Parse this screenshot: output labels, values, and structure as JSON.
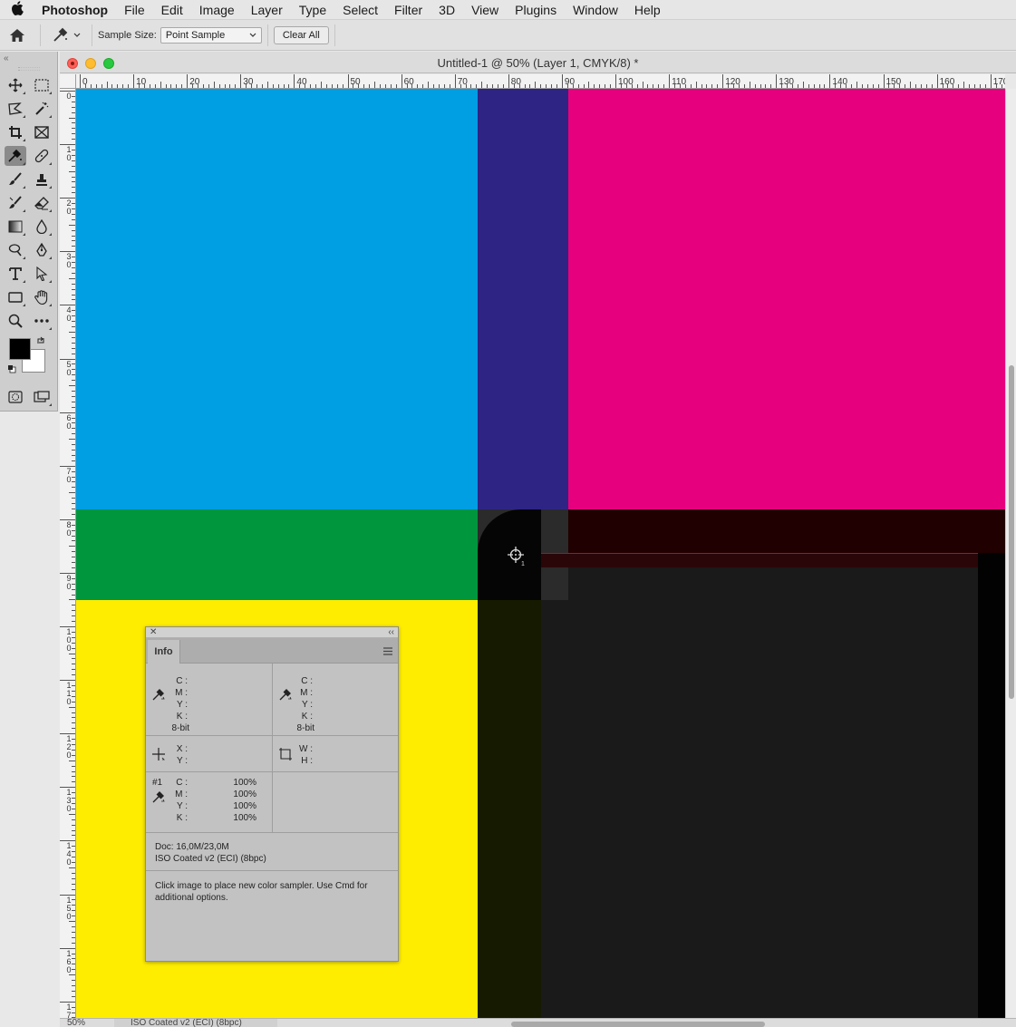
{
  "menubar": {
    "app_name": "Photoshop",
    "items": [
      "File",
      "Edit",
      "Image",
      "Layer",
      "Type",
      "Select",
      "Filter",
      "3D",
      "View",
      "Plugins",
      "Window",
      "Help"
    ]
  },
  "options_bar": {
    "sample_size_label": "Sample Size:",
    "sample_size_value": "Point Sample",
    "clear_all_label": "Clear All"
  },
  "document": {
    "title": "Untitled-1 @ 50% (Layer 1, CMYK/8) *",
    "zoom": "50%",
    "profile": "ISO Coated v2 (ECI) (8bpc)"
  },
  "rulers": {
    "horizontal_labels": [
      "0",
      "10",
      "20",
      "30",
      "40",
      "50",
      "60",
      "70",
      "80",
      "90",
      "100",
      "110",
      "120",
      "130",
      "140",
      "150",
      "160",
      "170"
    ],
    "vertical_labels": [
      "0",
      "10",
      "20",
      "30",
      "40",
      "50",
      "60",
      "70",
      "80",
      "90",
      "100",
      "110",
      "120",
      "130",
      "140",
      "150",
      "160",
      "170"
    ]
  },
  "canvas_colors": {
    "cyan": "#009ee3",
    "magenta": "#e6007e",
    "yellow": "#ffed00",
    "green": "#00963e",
    "navy": "#2e2484",
    "black": "#1a1a1a"
  },
  "info_panel": {
    "tab_label": "Info",
    "channel_labels": [
      "C :",
      "M :",
      "Y :",
      "K :"
    ],
    "bit_depth": "8-bit",
    "x_label": "X :",
    "y_label": "Y :",
    "w_label": "W :",
    "h_label": "H :",
    "sampler": {
      "name": "#1",
      "values": [
        "100%",
        "100%",
        "100%",
        "100%"
      ]
    },
    "doc_size": "Doc: 16,0M/23,0M",
    "doc_profile": "ISO Coated v2 (ECI) (8bpc)",
    "hint": "Click image to place new color sampler.  Use Cmd for additional options."
  }
}
